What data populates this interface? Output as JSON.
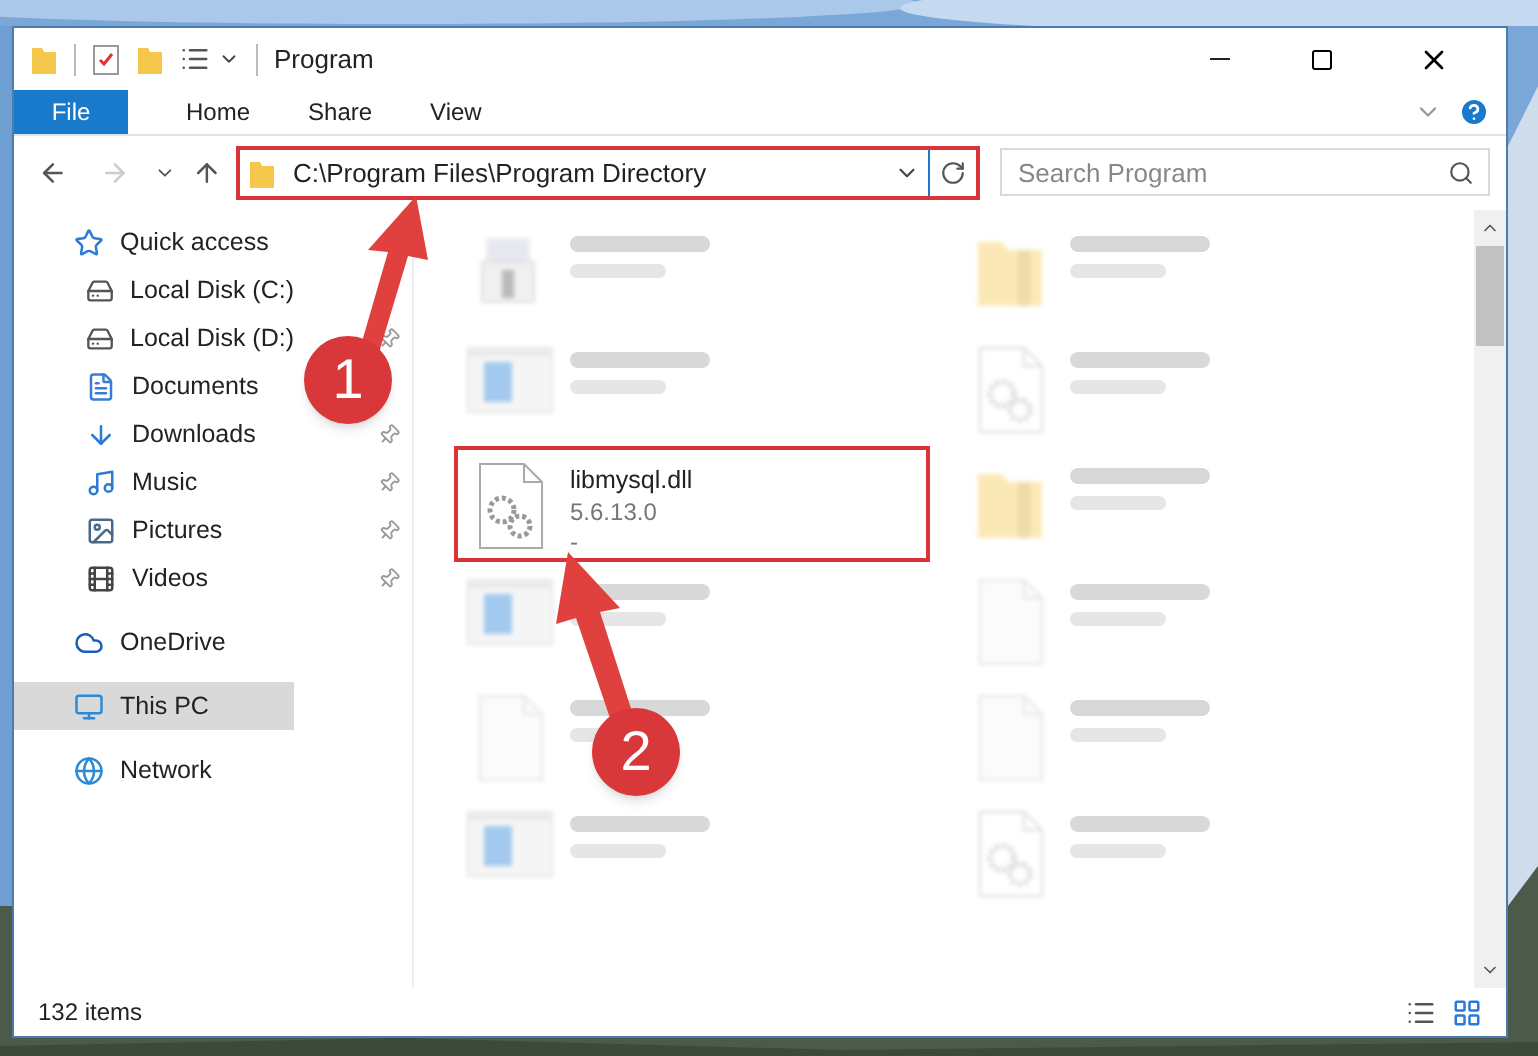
{
  "window": {
    "title": "Program"
  },
  "ribbon_tabs": [
    {
      "label": "File",
      "selected": true
    },
    {
      "label": "Home",
      "selected": false
    },
    {
      "label": "Share",
      "selected": false
    },
    {
      "label": "View",
      "selected": false
    }
  ],
  "address": {
    "path": "C:\\Program Files\\Program Directory",
    "highlighted": true
  },
  "search": {
    "placeholder": "Search Program"
  },
  "sidebar": {
    "items": [
      {
        "label": "Quick access",
        "kind": "star",
        "selected": false,
        "children": [
          {
            "label": "Local Disk (C:)",
            "kind": "disk",
            "selected": false
          },
          {
            "label": "Local Disk (D:)",
            "kind": "disk",
            "selected": false,
            "pinned": true
          },
          {
            "label": "Documents",
            "kind": "docs",
            "selected": false
          },
          {
            "label": "Downloads",
            "kind": "download",
            "selected": false,
            "pinned": true
          },
          {
            "label": "Music",
            "kind": "music",
            "selected": false,
            "pinned": true
          },
          {
            "label": "Pictures",
            "kind": "pictures",
            "selected": false,
            "pinned": true
          },
          {
            "label": "Videos",
            "kind": "videos",
            "selected": false,
            "pinned": true
          }
        ]
      },
      {
        "label": "OneDrive",
        "kind": "cloud",
        "selected": false
      },
      {
        "label": "This PC",
        "kind": "pc",
        "selected": true
      },
      {
        "label": "Network",
        "kind": "network",
        "selected": false
      }
    ]
  },
  "files": [
    {
      "kind": "installer",
      "faded": true
    },
    {
      "kind": "folder",
      "faded": true
    },
    {
      "kind": "app",
      "faded": true
    },
    {
      "kind": "dll",
      "faded": true
    },
    {
      "name": "libmysql.dll",
      "lines": [
        "5.6.13.0",
        "-"
      ],
      "kind": "dll",
      "faded": false,
      "highlighted": true
    },
    {
      "kind": "folder",
      "faded": true
    },
    {
      "kind": "app",
      "faded": true
    },
    {
      "kind": "blank",
      "faded": true
    },
    {
      "kind": "blank",
      "faded": true
    },
    {
      "kind": "blank",
      "faded": true
    },
    {
      "kind": "app",
      "faded": true
    },
    {
      "kind": "dll",
      "faded": true
    }
  ],
  "callouts": [
    {
      "label": "1"
    },
    {
      "label": "2"
    }
  ],
  "status_bar": {
    "count": "132 items"
  }
}
